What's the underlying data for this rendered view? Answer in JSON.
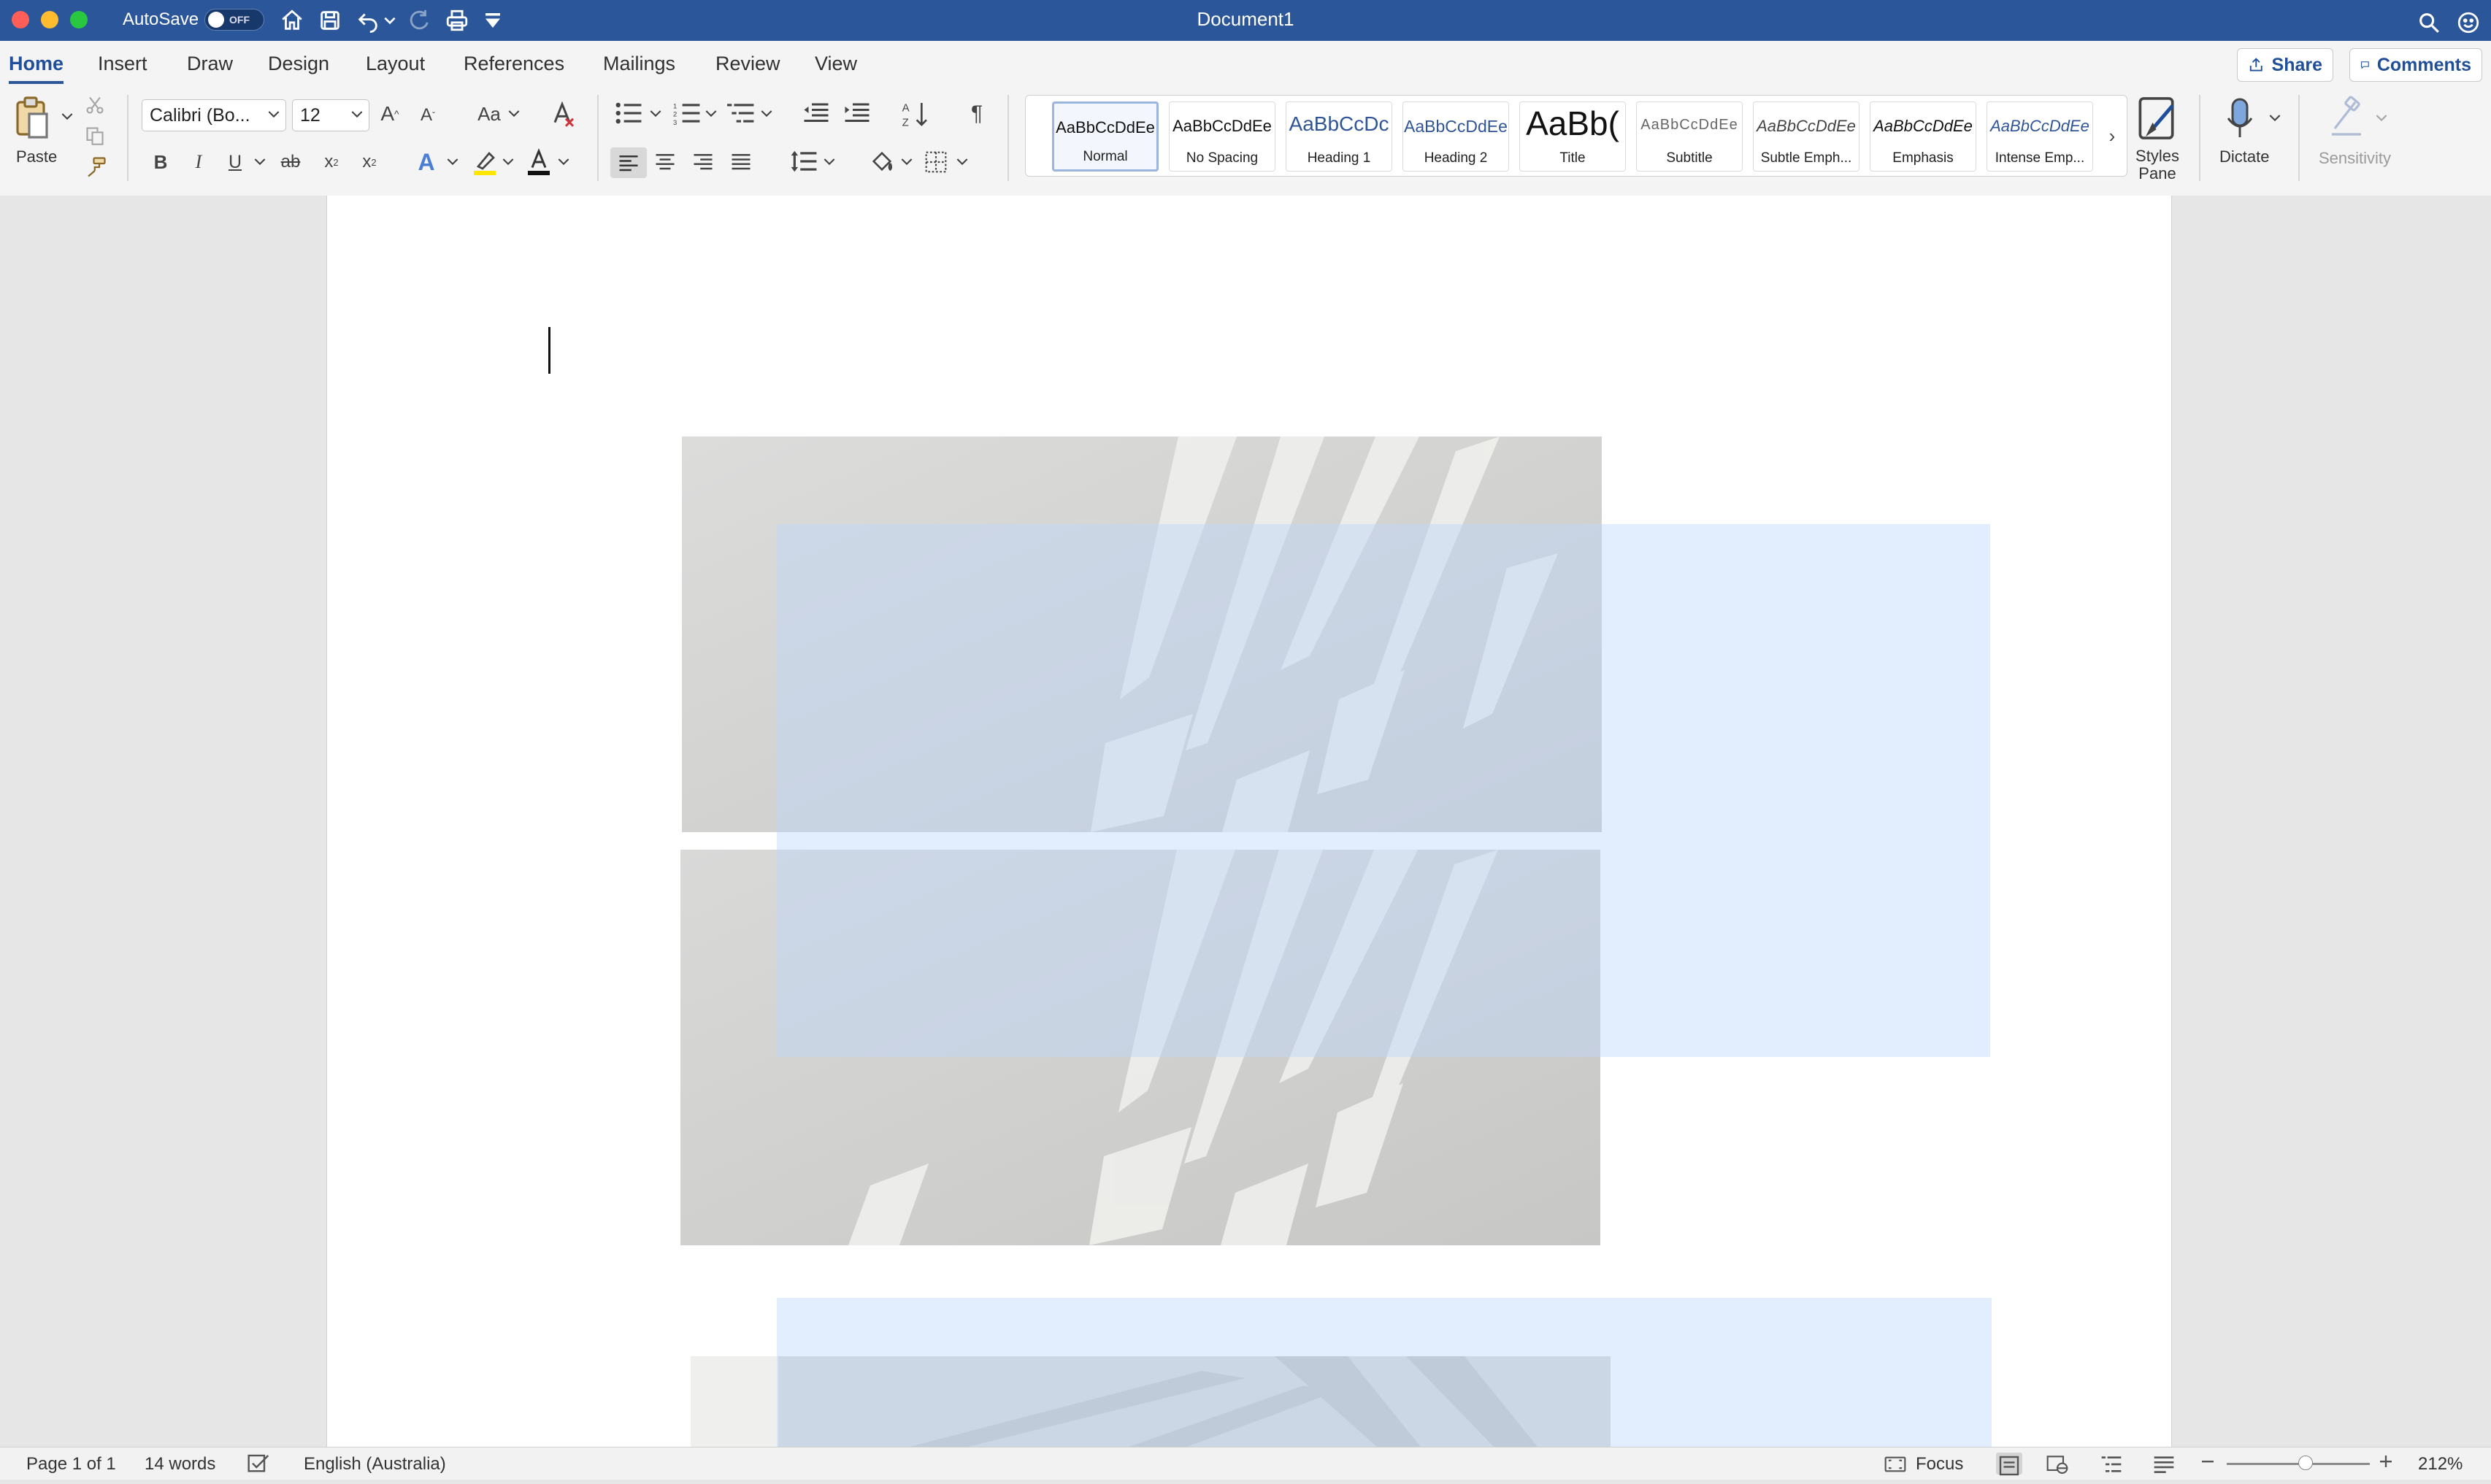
{
  "window": {
    "title": "Document1",
    "autosave_label": "AutoSave",
    "autosave_state": "OFF"
  },
  "tabs": [
    "Home",
    "Insert",
    "Draw",
    "Design",
    "Layout",
    "References",
    "Mailings",
    "Review",
    "View"
  ],
  "active_tab": "Home",
  "share_label": "Share",
  "comments_label": "Comments",
  "ribbon": {
    "paste_label": "Paste",
    "font_name": "Calibri (Bo...",
    "font_size": "12",
    "change_case_label": "Aa",
    "styles": [
      {
        "preview": "AaBbCcDdEe",
        "name": "Normal",
        "color": "#111111"
      },
      {
        "preview": "AaBbCcDdEe",
        "name": "No Spacing",
        "color": "#111111"
      },
      {
        "preview": "AaBbCcDc",
        "name": "Heading 1",
        "color": "#2f5597"
      },
      {
        "preview": "AaBbCcDdEe",
        "name": "Heading 2",
        "color": "#2f5597"
      },
      {
        "preview": "AaBb(",
        "name": "Title",
        "color": "#111111"
      },
      {
        "preview": "AaBbCcDdEe",
        "name": "Subtitle",
        "color": "#666666"
      },
      {
        "preview": "AaBbCcDdEe",
        "name": "Subtle Emph...",
        "color": "#444444"
      },
      {
        "preview": "AaBbCcDdEe",
        "name": "Emphasis",
        "color": "#111111"
      },
      {
        "preview": "AaBbCcDdEe",
        "name": "Intense Emp...",
        "color": "#2f5597"
      }
    ],
    "styles_pane_label_1": "Styles",
    "styles_pane_label_2": "Pane",
    "dictate_label": "Dictate",
    "sensitivity_label": "Sensitivity"
  },
  "status": {
    "page": "Page 1 of 1",
    "words": "14 words",
    "language": "English (Australia)",
    "focus_label": "Focus",
    "zoom": "212%",
    "zoom_fraction": 0.55
  },
  "colors": {
    "title_bar": "#2b579a",
    "accent": "#1f4e9a",
    "selection": "#bed7fa"
  }
}
